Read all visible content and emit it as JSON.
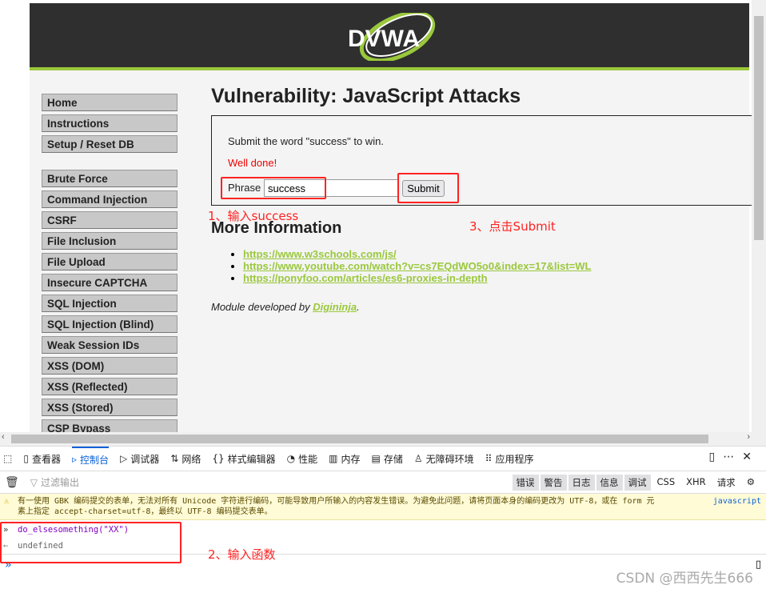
{
  "logo": "DVWA",
  "menu": {
    "group1": [
      "Home",
      "Instructions",
      "Setup / Reset DB"
    ],
    "group2": [
      "Brute Force",
      "Command Injection",
      "CSRF",
      "File Inclusion",
      "File Upload",
      "Insecure CAPTCHA",
      "SQL Injection",
      "SQL Injection (Blind)",
      "Weak Session IDs",
      "XSS (DOM)",
      "XSS (Reflected)",
      "XSS (Stored)",
      "CSP Bypass"
    ]
  },
  "main": {
    "title": "Vulnerability: JavaScript Attacks",
    "instruction": "Submit the word \"success\" to win.",
    "result": "Well done!",
    "phrase_label": "Phrase",
    "phrase_value": "success",
    "submit_label": "Submit",
    "more_title": "More Information",
    "links": [
      "https://www.w3schools.com/js/",
      "https://www.youtube.com/watch?v=cs7EQdWO5o0&index=17&list=WL",
      "https://ponyfoo.com/articles/es6-proxies-in-depth"
    ],
    "module_prefix": "Module developed by ",
    "module_author": "Digininja",
    "module_suffix": "."
  },
  "annotations": {
    "step1": "1、输入success",
    "step2": "2、输入函数",
    "step3": "3、点击Submit"
  },
  "devtools": {
    "tabs": [
      "查看器",
      "控制台",
      "调试器",
      "网络",
      "样式编辑器",
      "性能",
      "内存",
      "存储",
      "无障碍环境",
      "应用程序"
    ],
    "active_tab": "控制台",
    "filter_placeholder": "过滤输出",
    "levels": [
      "错误",
      "警告",
      "日志",
      "信息",
      "调试"
    ],
    "types": [
      "CSS",
      "XHR",
      "请求"
    ],
    "warning_line1": "有一使用 GBK 编码提交的表单，无法对所有 Unicode 字符进行编码，可能导致用户所输入的内容发生错误。为避免此问题，请将页面本身的编码更改为 UTF-8，或在 form 元",
    "warning_line2": "素上指定 accept-charset=utf-8，最终以 UTF-8 编码提交表单。",
    "warning_source": "javascript",
    "input": "do_elsesomething(\"XX\")",
    "output": "undefined"
  },
  "watermark": "CSDN @西西先生666",
  "colors": {
    "accent": "#9ac83c",
    "header": "#2f2f2f",
    "annotation": "#ff2222",
    "devtools_active": "#0a60d8"
  }
}
